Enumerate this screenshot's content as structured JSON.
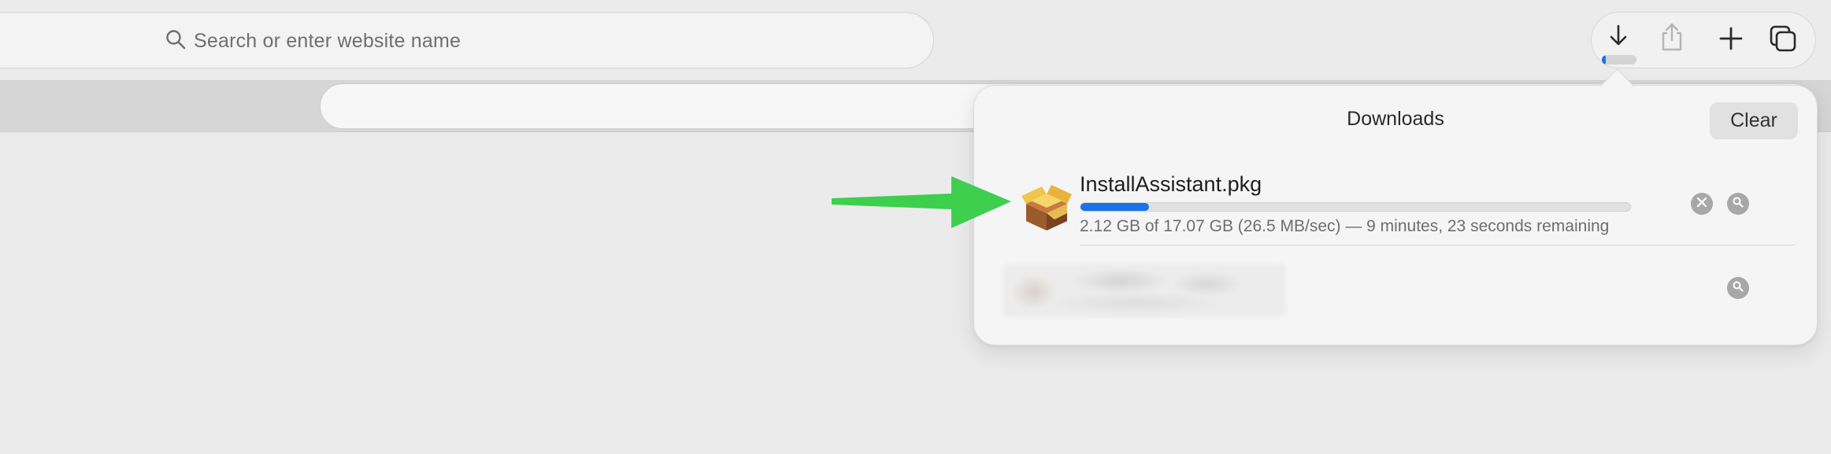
{
  "toolbar": {
    "search_placeholder": "Search or enter website name",
    "buttons": {
      "downloads": "downloads-icon",
      "share": "share-icon",
      "new_tab": "plus-icon",
      "tab_overview": "tabs-icon"
    },
    "download_progress": 0.12
  },
  "downloads_popover": {
    "title": "Downloads",
    "clear_label": "Clear",
    "items": [
      {
        "name": "InstallAssistant.pkg",
        "status": "2.12 GB of 17.07 GB (26.5 MB/sec) — 9 minutes, 23 seconds remaining",
        "progress": 0.124,
        "icon": "package-icon"
      }
    ]
  },
  "annotation": {
    "arrow_color": "#3ecf4f"
  },
  "colors": {
    "accent": "#1a73e8",
    "background": "#ebebeb"
  }
}
